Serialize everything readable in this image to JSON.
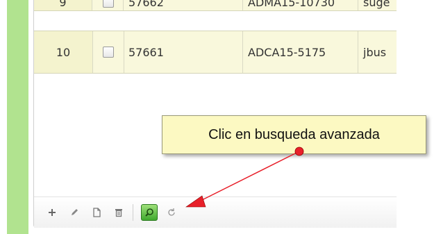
{
  "rows": [
    {
      "row_num": "9",
      "col1": "57662",
      "col2": "ADMA15-10730",
      "col3": "suge"
    },
    {
      "row_num": "10",
      "col1": "57661",
      "col2": "ADCA15-5175",
      "col3": "jbus"
    }
  ],
  "toolbar": {
    "add_icon": "plus-icon",
    "edit_icon": "pencil-icon",
    "view_icon": "document-icon",
    "delete_icon": "trash-icon",
    "search_icon": "search-icon",
    "refresh_icon": "refresh-icon"
  },
  "annotation": {
    "callout_text": "Clic en busqueda avanzada",
    "arrow_color": "#e8202a"
  },
  "colors": {
    "side_bar": "#b1e38f",
    "row_bg": "#f9f8dc",
    "callout_bg": "#fcf9c2",
    "active_button": "#3fa82e"
  }
}
